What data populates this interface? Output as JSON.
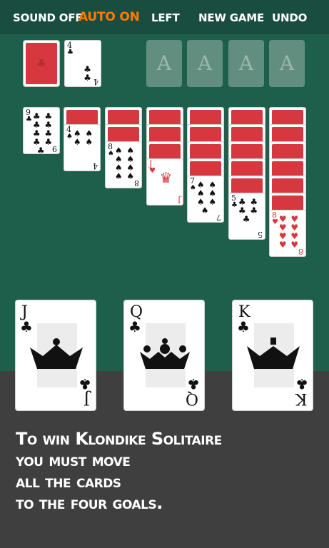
{
  "toolbar": {
    "sound": "SOUND OFF",
    "auto": "AUTO ON",
    "hand": "LEFT",
    "new_game": "NEW GAME",
    "undo": "UNDO",
    "auto_color": "#ff7a00"
  },
  "waste": {
    "rank": "4",
    "suit": "♣"
  },
  "foundations": [
    "A",
    "A",
    "A",
    "A"
  ],
  "tableau": [
    {
      "face_down": 0,
      "rank": "9",
      "suit": "♣",
      "red": false
    },
    {
      "face_down": 1,
      "rank": "4",
      "suit": "♠",
      "red": false
    },
    {
      "face_down": 2,
      "rank": "8",
      "suit": "♠",
      "red": false
    },
    {
      "face_down": 3,
      "rank": "J",
      "suit": "♥",
      "red": true
    },
    {
      "face_down": 4,
      "rank": "7",
      "suit": "♠",
      "red": false
    },
    {
      "face_down": 5,
      "rank": "5",
      "suit": "♣",
      "red": false
    },
    {
      "face_down": 6,
      "rank": "8",
      "suit": "♥",
      "red": true
    }
  ],
  "showcase": [
    {
      "rank": "J",
      "suit": "♣"
    },
    {
      "rank": "Q",
      "suit": "♣"
    },
    {
      "rank": "K",
      "suit": "♣"
    }
  ],
  "instruction_lines": [
    "To win Klondike Solitaire",
    "you must move",
    "all the cards",
    "to the four goals."
  ],
  "colors": {
    "felt": "#1e5f4c",
    "toolbar": "#194d3f",
    "card_back": "#d7373f",
    "bottom": "#3f3f3f"
  }
}
